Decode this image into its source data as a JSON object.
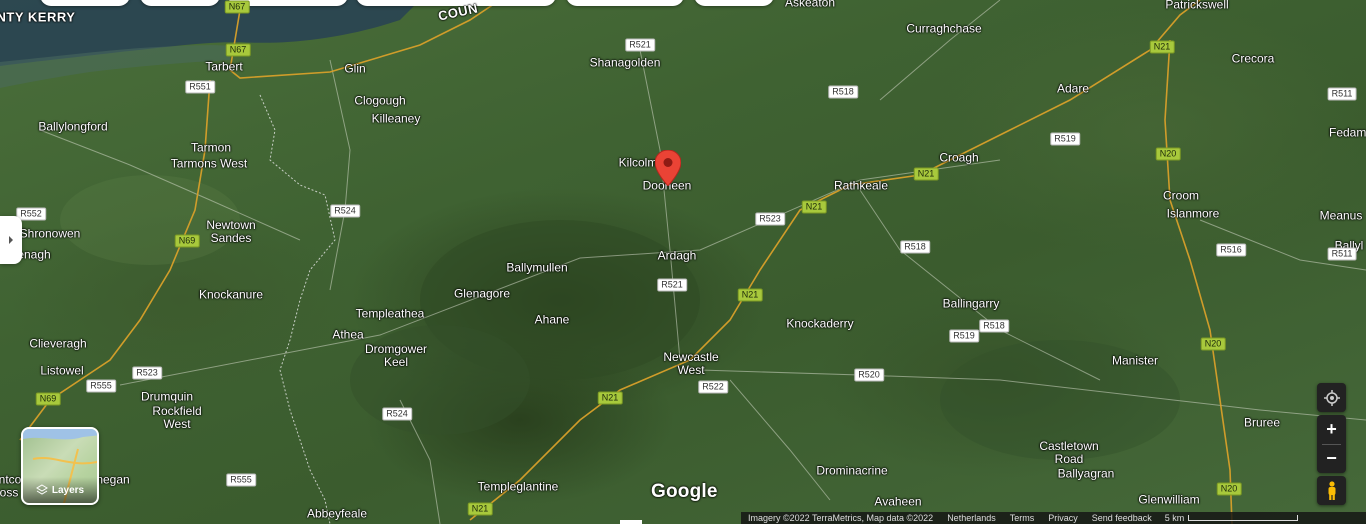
{
  "map": {
    "places": [
      {
        "id": "nty-kerry",
        "text": "NTY KERRY",
        "bold": true
      },
      {
        "id": "county",
        "text": "COUN",
        "bold": true
      },
      {
        "id": "askeaton",
        "text": "Askeaton"
      },
      {
        "id": "patrickswell",
        "text": "Patrickswell"
      },
      {
        "id": "curraghchase",
        "text": "Curraghchase"
      },
      {
        "id": "crecora",
        "text": "Crecora"
      },
      {
        "id": "tarbert",
        "text": "Tarbert"
      },
      {
        "id": "glin",
        "text": "Glin"
      },
      {
        "id": "shanagolden",
        "text": "Shanagolden"
      },
      {
        "id": "adare",
        "text": "Adare"
      },
      {
        "id": "clogough",
        "text": "Clogough"
      },
      {
        "id": "killeaney",
        "text": "Killeaney"
      },
      {
        "id": "ballylongford",
        "text": "Ballylongford"
      },
      {
        "id": "fedamore",
        "text": "Fedamo"
      },
      {
        "id": "tarmon",
        "text": "Tarmon"
      },
      {
        "id": "tarmons-west",
        "text": "Tarmons West"
      },
      {
        "id": "kilcolman",
        "text": "Kilcolm"
      },
      {
        "id": "dooneen",
        "text": "Dooneen"
      },
      {
        "id": "croagh",
        "text": "Croagh"
      },
      {
        "id": "rathkeale",
        "text": "Rathkeale"
      },
      {
        "id": "croom",
        "text": "Croom"
      },
      {
        "id": "islanmore",
        "text": "Islanmore"
      },
      {
        "id": "meanus",
        "text": "Meanus"
      },
      {
        "id": "shronowen",
        "text": "Shronowen"
      },
      {
        "id": "newtown-sandes",
        "text": "Newtown Sandes"
      },
      {
        "id": "lenagh",
        "text": "enagh"
      },
      {
        "id": "ballyl",
        "text": "Ballyl"
      },
      {
        "id": "ballymullen",
        "text": "Ballymullen"
      },
      {
        "id": "ardagh",
        "text": "Ardagh"
      },
      {
        "id": "glenagore",
        "text": "Glenagore"
      },
      {
        "id": "knockanure",
        "text": "Knockanure"
      },
      {
        "id": "templeathea",
        "text": "Templeathea"
      },
      {
        "id": "ballingarry",
        "text": "Ballingarry"
      },
      {
        "id": "ahane",
        "text": "Ahane"
      },
      {
        "id": "knockaderry",
        "text": "Knockaderry"
      },
      {
        "id": "athea",
        "text": "Athea"
      },
      {
        "id": "dromgower-keel",
        "text": "Dromgower Keel"
      },
      {
        "id": "clieveragh",
        "text": "Clieveragh"
      },
      {
        "id": "newcastle-west",
        "text": "Newcastle West"
      },
      {
        "id": "manister",
        "text": "Manister"
      },
      {
        "id": "listowel",
        "text": "Listowel"
      },
      {
        "id": "drumquin",
        "text": "Drumquin"
      },
      {
        "id": "rockfield-west",
        "text": "Rockfield West"
      },
      {
        "id": "bruree",
        "text": "Bruree"
      },
      {
        "id": "castletown-road",
        "text": "Castletown Road"
      },
      {
        "id": "ballyagran",
        "text": "Ballyagran"
      },
      {
        "id": "drominacrine",
        "text": "Drominacrine"
      },
      {
        "id": "cnegan",
        "text": "negan"
      },
      {
        "id": "ntcoo",
        "text": "ntco"
      },
      {
        "id": "ross",
        "text": "oss"
      },
      {
        "id": "templeglantine",
        "text": "Templeglantine"
      },
      {
        "id": "avaheen",
        "text": "Avaheen"
      },
      {
        "id": "glenwilliam",
        "text": "Glenwilliam"
      },
      {
        "id": "abbeyfeale",
        "text": "Abbeyfeale"
      }
    ],
    "road_shields": [
      {
        "id": "n67-a",
        "text": "N67",
        "type": "national"
      },
      {
        "id": "n67-b",
        "text": "N67",
        "type": "national"
      },
      {
        "id": "r521-a",
        "text": "R521",
        "type": "regional"
      },
      {
        "id": "n21-a",
        "text": "N21",
        "type": "national"
      },
      {
        "id": "r551",
        "text": "R551",
        "type": "regional"
      },
      {
        "id": "r518-a",
        "text": "R518",
        "type": "regional"
      },
      {
        "id": "r511-a",
        "text": "R511",
        "type": "regional"
      },
      {
        "id": "r519-a",
        "text": "R519",
        "type": "regional"
      },
      {
        "id": "n20-a",
        "text": "N20",
        "type": "national"
      },
      {
        "id": "n21-b",
        "text": "N21",
        "type": "national"
      },
      {
        "id": "r524-a",
        "text": "R524",
        "type": "regional"
      },
      {
        "id": "n21-c",
        "text": "N21",
        "type": "national"
      },
      {
        "id": "r552",
        "text": "R552",
        "type": "regional"
      },
      {
        "id": "r523",
        "text": "R523",
        "type": "regional"
      },
      {
        "id": "n69-a",
        "text": "N69",
        "type": "national"
      },
      {
        "id": "r518-b",
        "text": "R518",
        "type": "regional"
      },
      {
        "id": "r516",
        "text": "R516",
        "type": "regional"
      },
      {
        "id": "r511-b",
        "text": "R511",
        "type": "regional"
      },
      {
        "id": "r521-b",
        "text": "R521",
        "type": "regional"
      },
      {
        "id": "n21-d",
        "text": "N21",
        "type": "national"
      },
      {
        "id": "r518-c",
        "text": "R518",
        "type": "regional"
      },
      {
        "id": "r519-b",
        "text": "R519",
        "type": "regional"
      },
      {
        "id": "n20-b",
        "text": "N20",
        "type": "national"
      },
      {
        "id": "r523-b",
        "text": "R523",
        "type": "regional"
      },
      {
        "id": "r520",
        "text": "R520",
        "type": "regional"
      },
      {
        "id": "r555-a",
        "text": "R555",
        "type": "regional"
      },
      {
        "id": "r522",
        "text": "R522",
        "type": "regional"
      },
      {
        "id": "n69-b",
        "text": "N69",
        "type": "national"
      },
      {
        "id": "n21-e",
        "text": "N21",
        "type": "national"
      },
      {
        "id": "r524-b",
        "text": "R524",
        "type": "regional"
      },
      {
        "id": "r555-b",
        "text": "R555",
        "type": "regional"
      },
      {
        "id": "n20-c",
        "text": "N20",
        "type": "national"
      },
      {
        "id": "n21-f",
        "text": "N21",
        "type": "national"
      }
    ]
  },
  "controls": {
    "layers_label": "Layers",
    "zoom_in": "+",
    "zoom_out": "−",
    "google_logo": "Google"
  },
  "attribution": {
    "data": "Imagery ©2022 TerraMetrics, Map data ©2022",
    "region": "Netherlands",
    "terms": "Terms",
    "privacy": "Privacy",
    "feedback": "Send feedback",
    "scale": "5 km"
  },
  "colors": {
    "pin": "#ea4335",
    "national_road": "#a8c93c",
    "regional_road": "#ffffff"
  }
}
